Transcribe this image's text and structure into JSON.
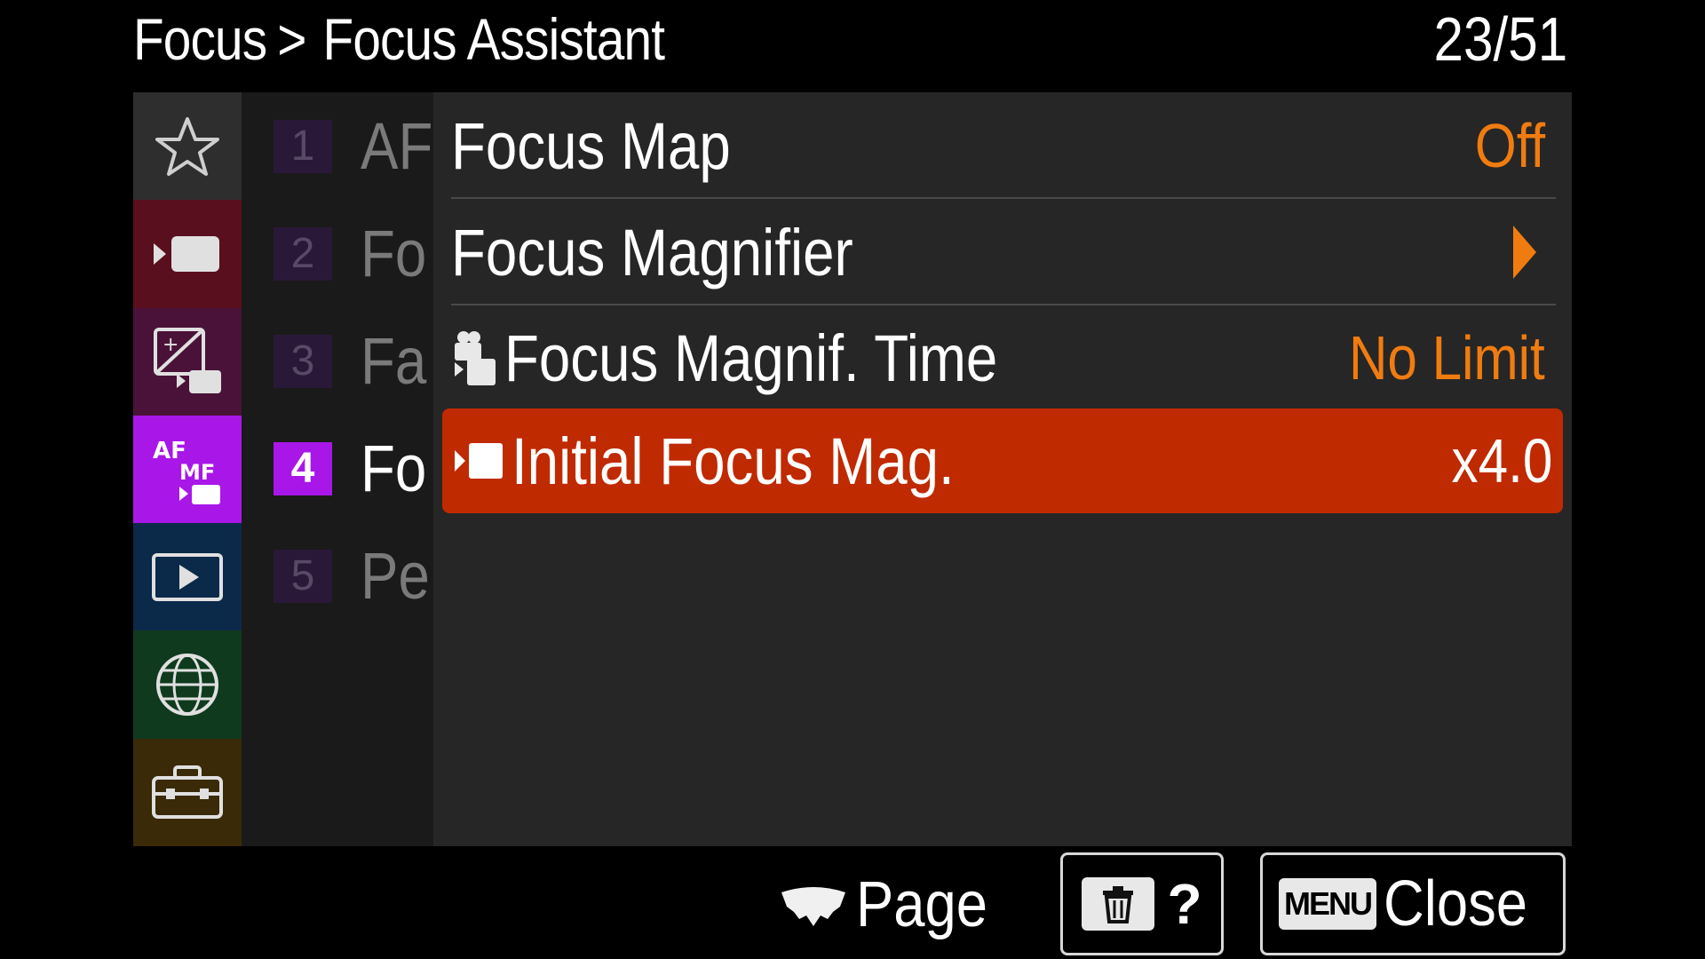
{
  "header": {
    "breadcrumb_parent": "Focus",
    "breadcrumb_separator": ">",
    "breadcrumb_current": "Focus Assistant",
    "page_counter": "23/51"
  },
  "categories": [
    {
      "icon": "star-icon",
      "color": "#2e2e2e"
    },
    {
      "icon": "camera-shooting-icon",
      "color": "#5a0f1e"
    },
    {
      "icon": "exposure-color-icon",
      "color": "#4a1238"
    },
    {
      "icon": "af-mf-icon",
      "color": "#a817e8",
      "active": true
    },
    {
      "icon": "playback-icon",
      "color": "#0b2a4a"
    },
    {
      "icon": "network-globe-icon",
      "color": "#0f3a1e"
    },
    {
      "icon": "toolbox-setup-icon",
      "color": "#3a2a08"
    }
  ],
  "pages": [
    {
      "num": "1",
      "label": "AF"
    },
    {
      "num": "2",
      "label": "Fo"
    },
    {
      "num": "3",
      "label": "Fa"
    },
    {
      "num": "4",
      "label": "Fo",
      "active": true
    },
    {
      "num": "5",
      "label": "Pe"
    }
  ],
  "settings": [
    {
      "label": "Focus Map",
      "value": "Off"
    },
    {
      "label": "Focus Magnifier",
      "value": ""
    },
    {
      "label": "Focus Magnif. Time",
      "value": "No Limit",
      "icon": "still-movie-icon"
    },
    {
      "label": "Initial Focus Mag.",
      "value": "x4.0",
      "icon": "movie-icon",
      "selected": true
    }
  ],
  "footer": {
    "page_label": "Page",
    "help_label": "?",
    "menu_key_label": "MENU",
    "close_label": "Close"
  },
  "colors": {
    "value_accent": "#f07c10",
    "selected_row": "#c02a00",
    "active_category": "#a817e8"
  }
}
